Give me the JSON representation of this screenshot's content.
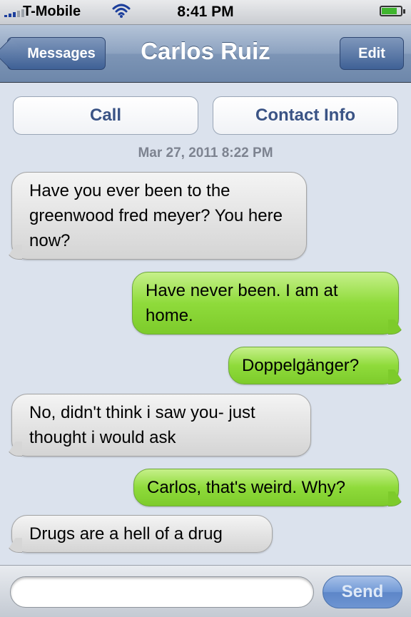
{
  "status_bar": {
    "carrier": "T-Mobile",
    "time": "8:41 PM",
    "signal_icon": "signal-bars-icon",
    "wifi_icon": "wifi-icon",
    "battery_icon": "battery-icon",
    "battery_level": 0.8
  },
  "nav": {
    "back_label": "Messages",
    "title": "Carlos Ruiz",
    "edit_label": "Edit"
  },
  "actions": {
    "call_label": "Call",
    "contact_info_label": "Contact Info"
  },
  "timestamp": "Mar 27, 2011 8:22 PM",
  "messages": [
    {
      "direction": "received",
      "text": "Have you ever been to the greenwood fred meyer? You here now?"
    },
    {
      "direction": "sent",
      "text": "Have never been. I am at home."
    },
    {
      "direction": "sent",
      "text": "Doppelgänger?"
    },
    {
      "direction": "received",
      "text": "No, didn't think i saw you- just thought i would ask"
    },
    {
      "direction": "sent",
      "text": "Carlos, that's weird. Why?"
    },
    {
      "direction": "received",
      "text": "Drugs are a hell of a drug"
    }
  ],
  "composer": {
    "placeholder": "",
    "value": "",
    "send_label": "Send"
  },
  "colors": {
    "sent_bubble": "#8fdb3b",
    "received_bubble": "#e4e4e4",
    "nav_bar": "#7d95b6",
    "background": "#dbe2ed"
  }
}
